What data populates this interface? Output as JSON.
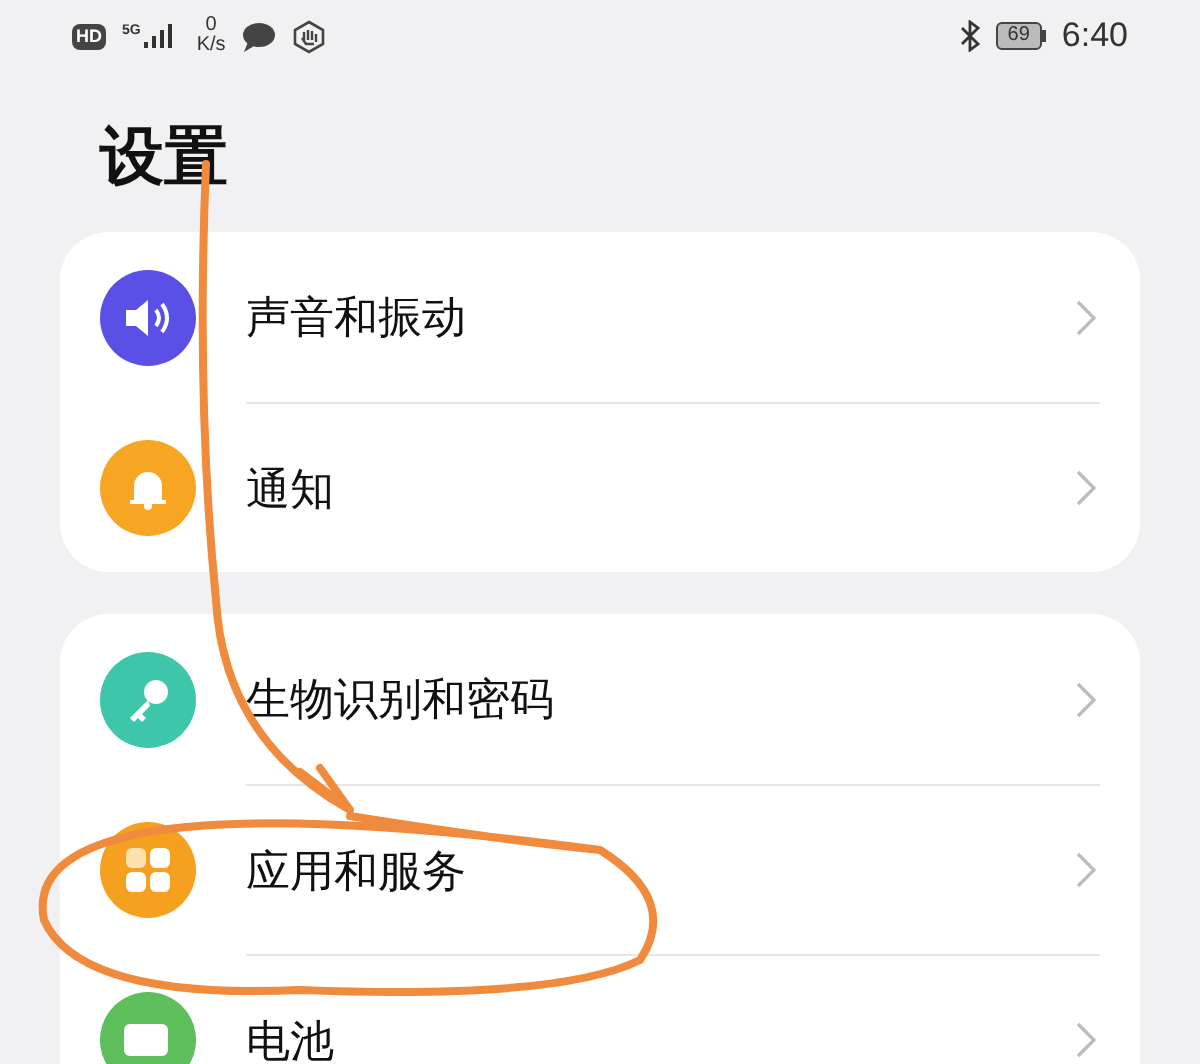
{
  "status_bar": {
    "hd": "HD",
    "network": "5G",
    "speed_value": "0",
    "speed_unit": "K/s",
    "battery": "69",
    "time": "6:40"
  },
  "title": "设置",
  "groups": [
    {
      "items": [
        {
          "label": "声音和振动",
          "color": "#5b50e6",
          "kind": "sound"
        },
        {
          "label": "通知",
          "color": "#f6a623",
          "kind": "bell"
        }
      ]
    },
    {
      "items": [
        {
          "label": "生物识别和密码",
          "color": "#3ec6aa",
          "kind": "key"
        },
        {
          "label": "应用和服务",
          "color": "#f6a020",
          "kind": "apps"
        },
        {
          "label": "电池",
          "color": "#5cbf5c",
          "kind": "battery"
        }
      ]
    }
  ]
}
